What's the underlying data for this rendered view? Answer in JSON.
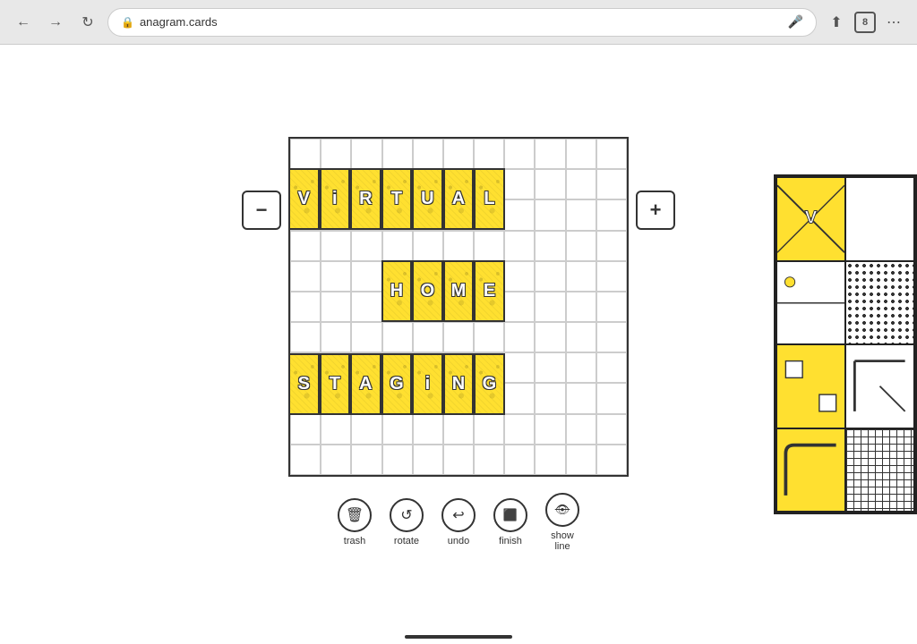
{
  "browser": {
    "url": "anagram.cards",
    "tab_count": "8"
  },
  "nav": {
    "back_disabled": false,
    "forward_disabled": false
  },
  "zoom": {
    "minus_label": "−",
    "plus_label": "+"
  },
  "words": {
    "line1": "VIRTUAL",
    "line2": "HOME",
    "line3": "STAGING"
  },
  "toolbar": {
    "trash_label": "trash",
    "rotate_label": "rotate",
    "undo_label": "undo",
    "finish_label": "finish",
    "show_line_label": "show\nline"
  },
  "grid": {
    "cols": 11,
    "rows": 11
  }
}
